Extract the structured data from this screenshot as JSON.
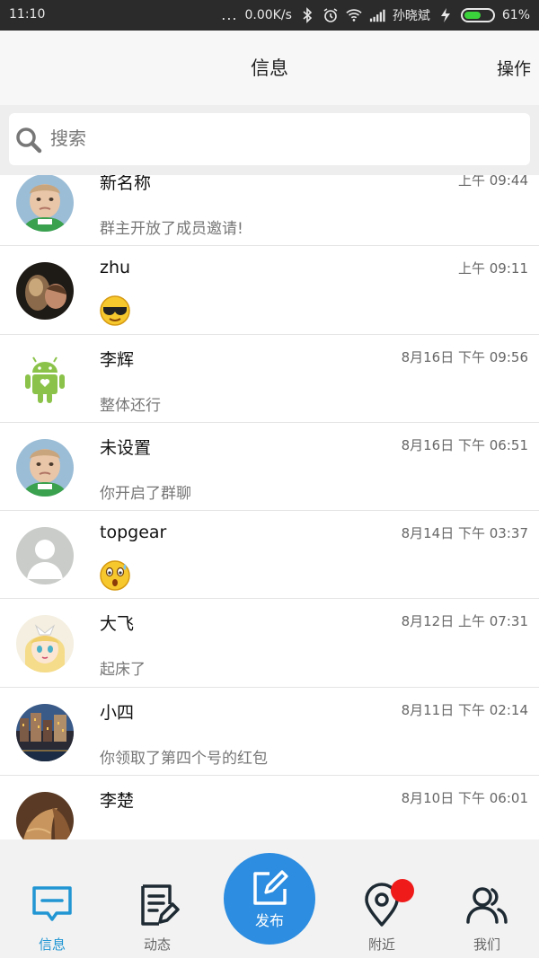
{
  "status_bar": {
    "time": "11:10",
    "dots": "...",
    "network_speed": "0.00K/s",
    "carrier": "孙晓斌",
    "battery_percent": "61%",
    "battery_level": 0.61
  },
  "header": {
    "title": "信息",
    "action": "操作"
  },
  "search": {
    "placeholder": "搜索"
  },
  "conversations": [
    {
      "name": "新名称",
      "time": "上午 09:44",
      "preview": "群主开放了成员邀请!",
      "avatar": "baby-avatar"
    },
    {
      "name": "zhu",
      "time": "上午 09:11",
      "preview": "",
      "emoji": "sunglasses-emoji",
      "avatar": "photo-avatar"
    },
    {
      "name": "李辉",
      "time": "8月16日 下午 09:56",
      "preview": "整体还行",
      "avatar": "android-avatar"
    },
    {
      "name": "未设置",
      "time": "8月16日 下午 06:51",
      "preview": "你开启了群聊",
      "avatar": "baby-avatar"
    },
    {
      "name": "topgear",
      "time": "8月14日 下午 03:37",
      "preview": "",
      "emoji": "surprised-emoji",
      "avatar": "default-avatar"
    },
    {
      "name": "大飞",
      "time": "8月12日 上午 07:31",
      "preview": "起床了",
      "avatar": "anime-avatar"
    },
    {
      "name": "小四",
      "time": "8月11日 下午 02:14",
      "preview": "你领取了第四个号的红包",
      "avatar": "city-avatar"
    },
    {
      "name": "李楚",
      "time": "8月10日 下午 06:01",
      "preview": "",
      "avatar": "interior-avatar"
    }
  ],
  "bottom_nav": {
    "messages": "信息",
    "moments": "动态",
    "publish": "发布",
    "nearby": "附近",
    "us": "我们"
  },
  "colors": {
    "accent": "#2196d3",
    "publish_bg": "#2d8de0",
    "badge": "#ef1b1b"
  }
}
